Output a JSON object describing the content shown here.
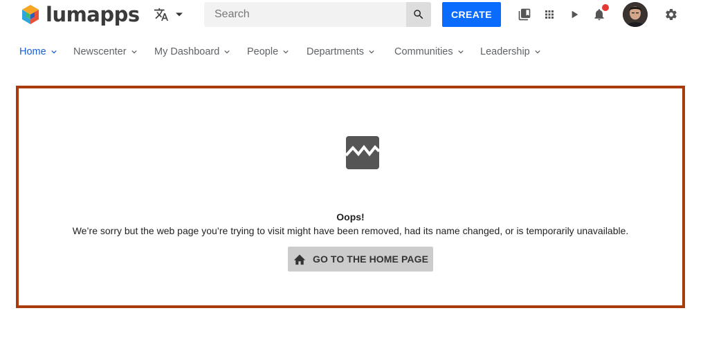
{
  "header": {
    "logo_text": "lumapps",
    "search": {
      "placeholder": "Search",
      "value": ""
    },
    "create_label": "CREATE",
    "icons": [
      "translate-icon",
      "library-icon",
      "apps-grid-icon",
      "play-icon",
      "bell-icon",
      "settings-icon"
    ],
    "accent_color": "#0a6cff",
    "notification_dot_color": "#e53935"
  },
  "nav": {
    "items": [
      {
        "label": "Home",
        "active": true
      },
      {
        "label": "Newscenter"
      },
      {
        "label": "My Dashboard"
      },
      {
        "label": "People"
      },
      {
        "label": "Departments"
      },
      {
        "label": "Communities"
      },
      {
        "label": "Leadership"
      }
    ],
    "active_color": "#1a5fd1"
  },
  "error": {
    "title": "Oops!",
    "message": "We’re sorry but the web page you’re trying to visit might have been removed, had its name changed, or is temporarily unavailable.",
    "home_button_label": "GO TO THE HOME PAGE",
    "icon": "broken-image-icon",
    "frame_color": "#a93a0c"
  }
}
